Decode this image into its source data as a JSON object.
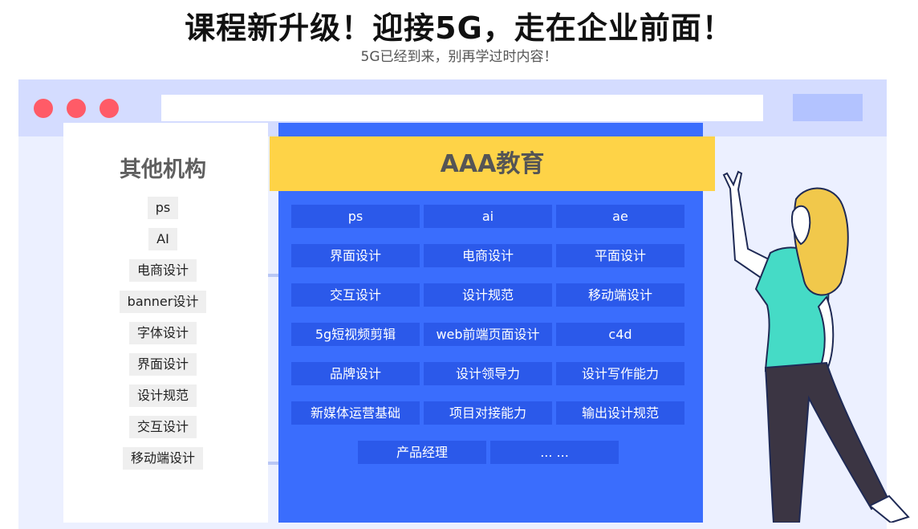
{
  "headline": "课程新升级！迎接5G，走在企业前面！",
  "subheadline": "5G已经到来，别再学过时内容！",
  "colors": {
    "primary_blue": "#3a6dfd",
    "chip_blue": "#2b59ea",
    "banner_yellow": "#fed347",
    "window_dot_red": "#ff5b67",
    "browser_bar": "#d4dcff"
  },
  "left_panel": {
    "title": "其他机构",
    "items": [
      "ps",
      "AI",
      "电商设计",
      "banner设计",
      "字体设计",
      "界面设计",
      "设计规范",
      "交互设计",
      "移动端设计"
    ]
  },
  "main_panel": {
    "title": "AAA教育",
    "rows": [
      [
        "ps",
        "ai",
        "ae"
      ],
      [
        "界面设计",
        "电商设计",
        "平面设计"
      ],
      [
        "交互设计",
        "设计规范",
        "移动端设计"
      ],
      [
        "5g短视频剪辑",
        "web前端页面设计",
        "c4d"
      ],
      [
        "品牌设计",
        "设计领导力",
        "设计写作能力"
      ],
      [
        "新媒体运营基础",
        "项目对接能力",
        "输出设计规范"
      ],
      [
        "产品经理",
        "... ..."
      ]
    ]
  }
}
